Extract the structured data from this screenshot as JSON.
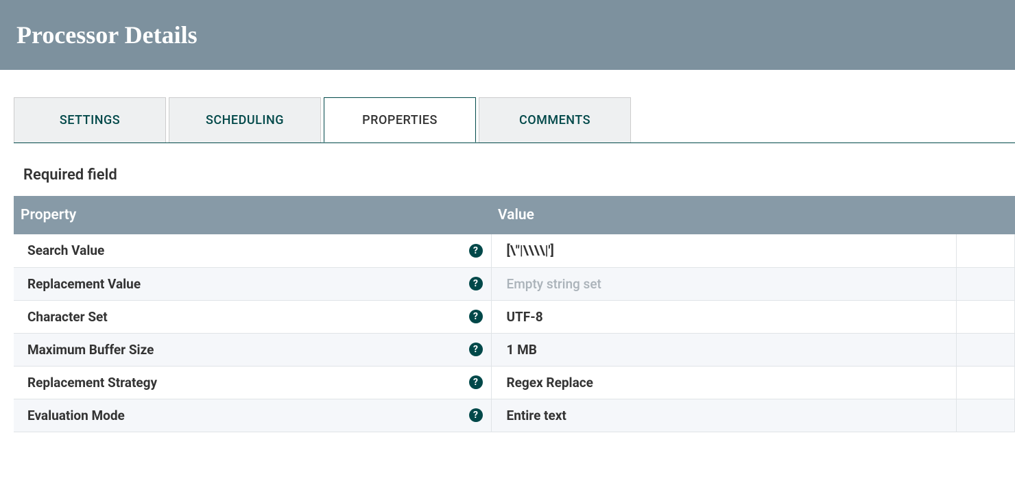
{
  "header": {
    "title": "Processor Details"
  },
  "tabs": [
    {
      "label": "SETTINGS",
      "active": false
    },
    {
      "label": "SCHEDULING",
      "active": false
    },
    {
      "label": "PROPERTIES",
      "active": true
    },
    {
      "label": "COMMENTS",
      "active": false
    }
  ],
  "section": {
    "required_label": "Required field"
  },
  "table": {
    "columns": {
      "property": "Property",
      "value": "Value"
    },
    "rows": [
      {
        "property": "Search Value",
        "value": "[\\\"|\\\\\\\\|']",
        "placeholder": false
      },
      {
        "property": "Replacement Value",
        "value": "Empty string set",
        "placeholder": true
      },
      {
        "property": "Character Set",
        "value": "UTF-8",
        "placeholder": false
      },
      {
        "property": "Maximum Buffer Size",
        "value": "1 MB",
        "placeholder": false
      },
      {
        "property": "Replacement Strategy",
        "value": "Regex Replace",
        "placeholder": false
      },
      {
        "property": "Evaluation Mode",
        "value": "Entire text",
        "placeholder": false
      }
    ]
  },
  "icons": {
    "help_glyph": "?"
  }
}
